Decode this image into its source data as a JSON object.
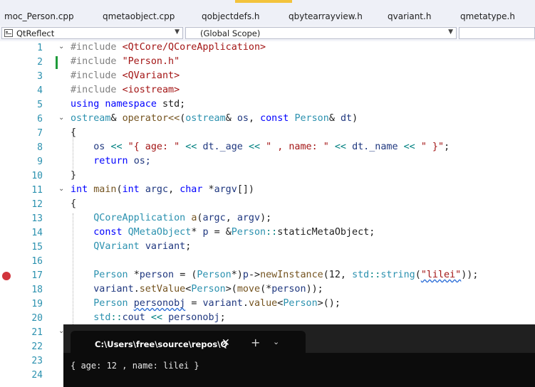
{
  "tabs": [
    "moc_Person.cpp",
    "qmetaobject.cpp",
    "qobjectdefs.h",
    "qbytearrayview.h",
    "qvariant.h",
    "qmetatype.h"
  ],
  "navbar": {
    "project": "QtReflect",
    "scope": "(Global Scope)"
  },
  "line_numbers": [
    "1",
    "2",
    "3",
    "4",
    "5",
    "6",
    "7",
    "8",
    "9",
    "10",
    "11",
    "12",
    "13",
    "14",
    "15",
    "16",
    "17",
    "18",
    "19",
    "20",
    "21",
    "22",
    "23",
    "24"
  ],
  "code": {
    "l1": [
      "#include",
      "<QtCore/QCoreApplication>"
    ],
    "l2": [
      "#include",
      "\"Person.h\""
    ],
    "l3": [
      "#include",
      "<QVariant>"
    ],
    "l4": [
      "#include",
      "<iostream>"
    ],
    "l5": [
      "using",
      "namespace",
      "std;"
    ],
    "l6": [
      "ostream",
      "&",
      "operator<<",
      "(",
      "ostream",
      "&",
      "os",
      ",",
      "const",
      "Person",
      "&",
      "dt",
      ")"
    ],
    "l7": [
      "{"
    ],
    "l8": [
      "os",
      "<<",
      "\"{ age: \"",
      "<<",
      "dt.",
      "_age",
      "<<",
      "\" , name: \"",
      "<<",
      "dt.",
      "_name",
      "<<",
      "\" }\"",
      ";"
    ],
    "l9": [
      "return",
      "os;"
    ],
    "l10": [
      "}"
    ],
    "l11": [
      "int",
      "main",
      "(",
      "int",
      "argc",
      ",",
      "char",
      "*",
      "argv",
      "[])"
    ],
    "l12": [
      "{"
    ],
    "l13": [
      "QCoreApplication",
      "a",
      "(",
      "argc",
      ",",
      "argv",
      ");"
    ],
    "l14": [
      "const",
      "QMetaObject",
      "*",
      "p",
      "=",
      "&",
      "Person",
      "::",
      "staticMetaObject",
      ";"
    ],
    "l15": [
      "QVariant",
      "variant",
      ";"
    ],
    "l17": [
      "Person",
      "*",
      "person",
      "=",
      "(",
      "Person",
      "*)",
      "p",
      "->",
      "newInstance",
      "(12,",
      "std",
      "::",
      "string",
      "(",
      "\"lilei\"",
      "));"
    ],
    "l18": [
      "variant",
      ".",
      "setValue",
      "<",
      "Person",
      ">(",
      "move",
      "(*",
      "person",
      "));"
    ],
    "l19": [
      "Person",
      "personobj",
      "=",
      "variant",
      ".",
      "value",
      "<",
      "Person",
      ">();"
    ],
    "l20": [
      "std",
      "::",
      "cout",
      "<<",
      "personobj",
      ";"
    ]
  },
  "terminal": {
    "tab_title": "C:\\Users\\free\\source\\repos\\Q",
    "close_glyph": "✕",
    "new_tab_glyph": "+",
    "dropdown_glyph": "⌄",
    "output": "{ age: 12 , name: lilei }"
  },
  "colors": {
    "keyword": "#0000ff",
    "preprocessor": "#808080",
    "string": "#a31515",
    "type": "#2b91af",
    "function": "#74531f",
    "variable": "#1f377f",
    "line_number": "#2b91af",
    "breakpoint": "#d1343c",
    "change_marker": "#1e9b3a",
    "terminal_bg": "#0c0c0c"
  },
  "icons": [
    "project-icon",
    "chevron-down-icon",
    "breakpoint-icon",
    "fold-icon",
    "close-icon",
    "plus-icon"
  ]
}
